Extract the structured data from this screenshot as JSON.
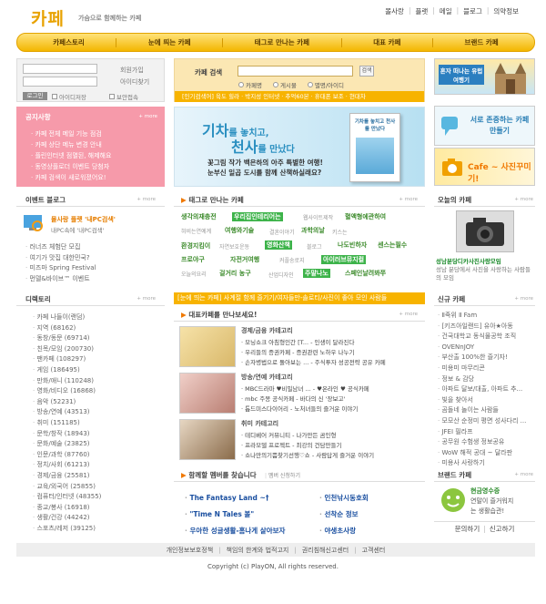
{
  "header": {
    "logo": "카페",
    "slogan": "가슴으로 함께하는 카페",
    "top_links": [
      "몰사랑",
      "플랫",
      "메일",
      "블로그",
      "의약정보"
    ]
  },
  "gnb": [
    "카페스토리",
    "눈에 띄는 카페",
    "태그로 만나는 카페",
    "대표 카페",
    "브랜드 카페"
  ],
  "login": {
    "join": "회원가입",
    "find_id": "아이디찾기",
    "login_btn": "로그인",
    "save_id": "아이디저장",
    "secure": "보안접속"
  },
  "search": {
    "title": "카페 검색",
    "button": "검색",
    "options": [
      "카페명",
      "게시물",
      "별명/아이디"
    ],
    "popular": "[인기검색어] 육도 힐라 · 박지성 인터넷 · 추억60본 · 휴대폰 보조 · 현대차"
  },
  "right_banners": {
    "b1": "혼자 떠나는 유럽여행기",
    "b2": "서로 존중하는 카페 만들기",
    "b3": "Cafe ~ 사진꾸미기!"
  },
  "notice": {
    "title": "공지사항",
    "more": "+ more",
    "items": [
      "카페 전체 메일 기능 점검",
      "카페 상단 메뉴 변경 안내",
      "플린인터넷 점멸된, 해제해요",
      "동영상플로더 이벤트 당첨자",
      "카페 검색이 새로워졌어요!"
    ]
  },
  "main_banner": {
    "headline1": "기차",
    "headline2": "를 놓치고,",
    "headline3": "천사",
    "headline4": "를 만났다",
    "line1": "꽃그림 작가 백은하의 아주 특별한 여행!",
    "line2": "눈부신 일곱 도시를 함께 산책하실래요?",
    "book": "기차를 놓치고 천사를 만났다"
  },
  "event_blog": {
    "title": "이벤트 블로그",
    "more": "+ more",
    "feature_title": "몰사랑 플랫 '내PC검색'",
    "feature_sub": "내PC속에 '내PC검색'",
    "items": [
      "러너즈 체험단 모집",
      "여기가 맛집 대한민국?",
      "미즈마 Spring Festival",
      "먼델&바이브™ 이벤트"
    ]
  },
  "directory": {
    "title": "디렉토리",
    "more": "+ more",
    "items": [
      "카페 나들이(랜덤)",
      "지역 (68162)",
      "동창/동문 (69714)",
      "친목/모임 (200730)",
      "팬카페 (108297)",
      "게임 (186495)",
      "만화/애니 (110248)",
      "영화/비디오 (16868)",
      "음악 (52231)",
      "방송/연예 (43513)",
      "취미 (151185)",
      "문학/창작 (18943)",
      "문화/예술 (23825)",
      "인문/과학 (87760)",
      "정치/사회 (61213)",
      "경제/금융 (25581)",
      "교육/외국어 (25855)",
      "컴퓨터/인터넷 (48355)",
      "종교/봉사 (16918)",
      "생활/건강 (44242)",
      "스포츠/레저 (39125)"
    ]
  },
  "tag_section": {
    "title": "태그로 만나는 카페",
    "more": "+ more",
    "tags": [
      {
        "t": "생각의재충전",
        "k": "gt"
      },
      {
        "t": "우리집인테리어는",
        "k": "g"
      },
      {
        "t": "웹사이트제작",
        "k": "s"
      },
      {
        "t": "혈액형에관하여",
        "k": "gt"
      },
      {
        "t": "혀비는연예계",
        "k": "s"
      },
      {
        "t": "여행와기술",
        "k": "gt"
      },
      {
        "t": "결혼이야기",
        "k": "s"
      },
      {
        "t": "과학의날",
        "k": "gt"
      },
      {
        "t": "키스는",
        "k": "s"
      },
      {
        "t": "환경지킴이",
        "k": "gt"
      },
      {
        "t": "자연보호운동",
        "k": "s"
      },
      {
        "t": "영화산책",
        "k": "g"
      },
      {
        "t": "블로그",
        "k": "s"
      },
      {
        "t": "나도빈하자",
        "k": "gt"
      },
      {
        "t": "센스는필수",
        "k": "gt"
      },
      {
        "t": "프로야구",
        "k": "gt"
      },
      {
        "t": "자전거여행",
        "k": "gt"
      },
      {
        "t": "커플송로지",
        "k": "s"
      },
      {
        "t": "아이러브뮤지컬",
        "k": "g"
      },
      {
        "t": "오늘의요리",
        "k": "s"
      },
      {
        "t": "걸거리 농구",
        "k": "gt"
      },
      {
        "t": "산업디자인",
        "k": "s"
      },
      {
        "t": "주말나노",
        "k": "g"
      },
      {
        "t": "스페인날려봐쭈",
        "k": "gt"
      }
    ]
  },
  "hot_bar": "[눈에 띄는 카페] 사계절 함께 즐기기/여자들만-솔로티/사진이 좋아 모인 사람들",
  "rep_cafe": {
    "title": "대표카페를 만나보세요!",
    "more": "+ more",
    "groups": [
      {
        "cat": "경제/금융 카테고리",
        "items": [
          "모닝쇼크 아침형인간 [T... - 인생이 달라진다",
          "우리들의 증권카페 - 증권관련 노하우 나누기",
          "손자병법으로 돌아보는 ... - 주식투자 성공전략 공유 카페"
        ]
      },
      {
        "cat": "방송/연예 카테고리",
        "items": [
          "MBC드라마 ♥비밀남녀 ... - ♥온라인 ♥ 공식카페",
          "mbc 주몽 공식카페 - 바다의 신 '장보고'",
          "톱드미스다이어리 - 노처녀들의 즐거운 이야기"
        ]
      },
      {
        "cat": "취미 카테고리",
        "items": [
          "테디베어 커뮤니티 - 나가만든 곰인형",
          "프라모델 프로젝트 - 최강의 건담만들기",
          "쇼나만의기쁨찾기선행♡쇼 - 사람답게 즐거운 이야기"
        ]
      }
    ]
  },
  "members": {
    "title": "함께할 멤버를 찾습니다",
    "sub": "멤버 신청하기",
    "items": [
      "The Fantasy Land ~†",
      "인천낚시동호회",
      "\"Time N Tales 볼\"",
      "선착순 정보",
      "우아한 성글생활-홈나게 살아보자",
      "야생초사랑"
    ]
  },
  "today_cafe": {
    "title": "오늘의 카페",
    "more": "+ more",
    "name": "성남분당디카사진사랑모임",
    "desc": "성남 분당에서 사진을 사랑하는 사람들의 모임"
  },
  "new_cafe": {
    "title": "신규 카페",
    "more": "+ more",
    "items": [
      "Ⅱ죽위 Ⅱ Fam",
      "[키즈아일랜드] 유아★아동",
      "건국대학교 동식물공학 조직",
      "OVENnJOY",
      "부산출 100%한 즐기자!",
      "미용미 마무리콘",
      "정보 & 감당",
      "아파트 달보/대출, 아파트 추...",
      "빛을 찾아서",
      "곰돌네 놀이는 사람들",
      "모모산 순정미 평면 성사다리 ...",
      "JFEI 필라프",
      "공무원 수험생 정보공유",
      "WoW 해적 공대 ~ 달라판",
      "미용사 사랑하기"
    ]
  },
  "brand_cafe": {
    "title": "브랜드 카페",
    "more": "+ more",
    "b1": "현금영수증",
    "b2": "연말이 즐거워지",
    "b3": "는 생활습관!",
    "faq": "문의하기",
    "apply": "신고하기"
  },
  "footer": {
    "links": [
      "개인정보보호정책",
      "책임의 한계와 법적고지",
      "권리침해신고센터",
      "고객센터"
    ],
    "copyright": "Copyright (c) PlayON, All rights reserved."
  }
}
